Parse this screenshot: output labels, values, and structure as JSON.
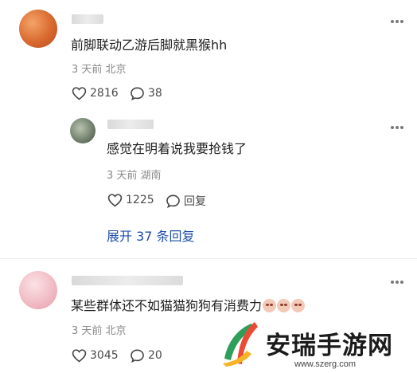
{
  "comments": [
    {
      "text": "前脚联动乙游后脚就黑猴hh",
      "meta": "3 天前 北京",
      "likes": "2816",
      "replies": "38"
    },
    {
      "text": "感觉在明着说我要抢钱了",
      "meta": "3 天前 湖南",
      "likes": "1225",
      "reply_label": "回复"
    },
    {
      "text": "某些群体还不如猫猫狗狗有消费力",
      "meta": "3 天前 北京",
      "likes": "3045",
      "replies": "20",
      "emoji_count": 3
    }
  ],
  "expand_replies": "展开 37 条回复",
  "watermark": {
    "title": "安瑞手游网",
    "url": "www.szerg.com"
  },
  "icons": [
    "more-icon",
    "heart-icon",
    "comment-icon"
  ],
  "colors": {
    "link": "#1f4fa8",
    "meta": "#8a8a8a",
    "avatar1": "#e07a3a",
    "avatar3": "#f2c9cf"
  }
}
